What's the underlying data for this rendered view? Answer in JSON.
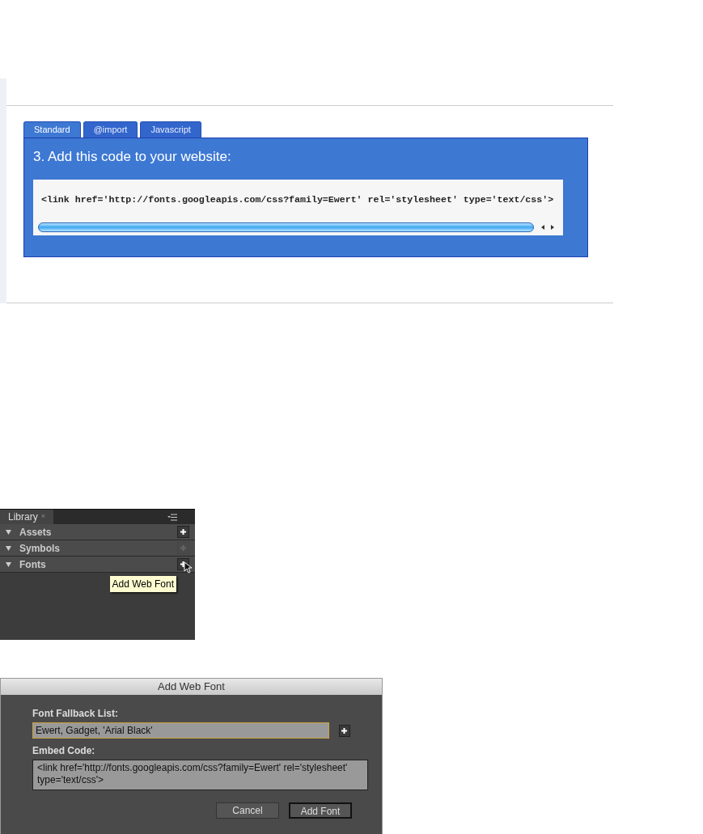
{
  "code_panel": {
    "tabs": [
      {
        "label": "Standard",
        "selected": true
      },
      {
        "label": "@import",
        "selected": false
      },
      {
        "label": "Javascript",
        "selected": false
      }
    ],
    "heading": "3. Add this code to your website:",
    "code": "<link href='http://fonts.googleapis.com/css?family=Ewert' rel='stylesheet' type='text/css'>"
  },
  "library": {
    "title": "Library",
    "close": "×",
    "sections": [
      {
        "label": "Assets",
        "enabled": true
      },
      {
        "label": "Symbols",
        "enabled": false
      },
      {
        "label": "Fonts",
        "enabled": true
      }
    ],
    "tooltip": "Add Web Font"
  },
  "dialog": {
    "title": "Add Web Font",
    "fallback_label": "Font Fallback List:",
    "fallback_value": "Ewert, Gadget, 'Arial Black'",
    "embed_label": "Embed Code:",
    "embed_value": "<link href='http://fonts.googleapis.com/css?family=Ewert' rel='stylesheet' type='text/css'>",
    "buttons": [
      {
        "label": "Cancel",
        "default": false
      },
      {
        "label": "Add Font",
        "default": true
      }
    ]
  }
}
